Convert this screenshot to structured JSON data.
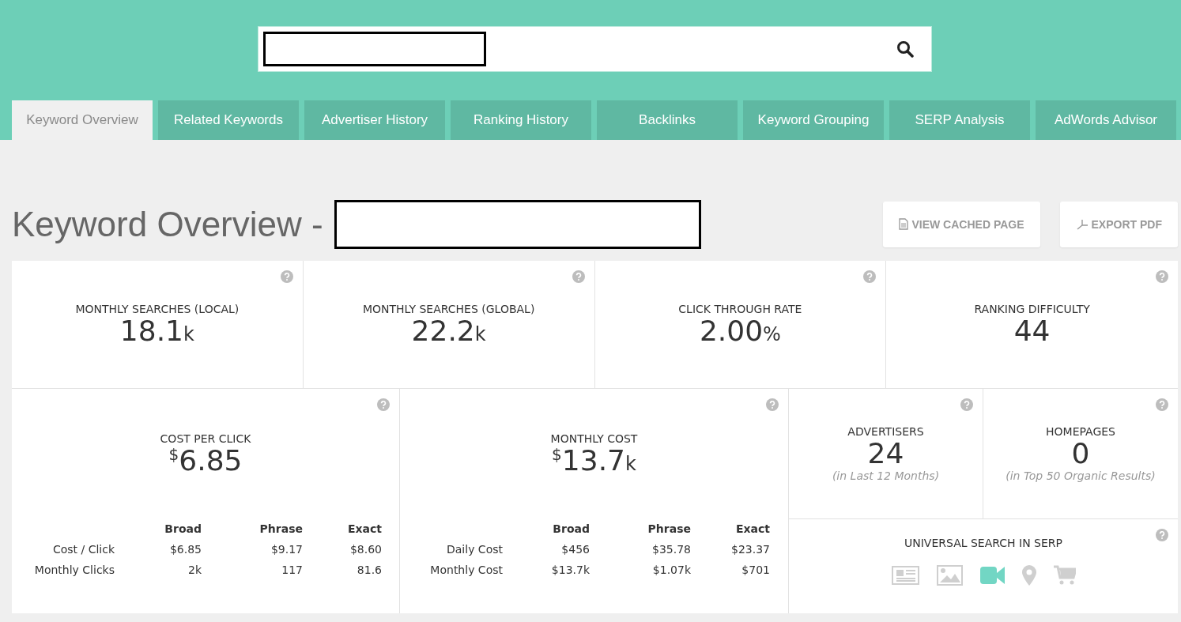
{
  "search": {
    "redacted": true
  },
  "tabs": [
    {
      "label": "Keyword Overview",
      "selected": true
    },
    {
      "label": "Related Keywords",
      "selected": false
    },
    {
      "label": "Advertiser History",
      "selected": false
    },
    {
      "label": "Ranking History",
      "selected": false
    },
    {
      "label": "Backlinks",
      "selected": false
    },
    {
      "label": "Keyword Grouping",
      "selected": false
    },
    {
      "label": "SERP Analysis",
      "selected": false
    },
    {
      "label": "AdWords Advisor",
      "selected": false
    }
  ],
  "page_title": {
    "text": "Keyword Overview -",
    "redacted": true
  },
  "actions": [
    {
      "label": "VIEW CACHED PAGE",
      "kind": "document"
    },
    {
      "label": "EXPORT PDF",
      "kind": "pdf"
    }
  ],
  "metrics": [
    {
      "label": "MONTHLY SEARCHES (LOCAL)",
      "value": "18.1",
      "unit": "k"
    },
    {
      "label": "MONTHLY SEARCHES (GLOBAL)",
      "value": "22.2",
      "unit": "k"
    },
    {
      "label": "CLICK THROUGH RATE",
      "value": "2.00",
      "unit": "%"
    },
    {
      "label": "RANKING DIFFICULTY",
      "value": "44"
    }
  ],
  "cost_panels": [
    {
      "label": "COST PER CLICK",
      "prefix": "$",
      "value": "6.85",
      "columns": [
        "Broad",
        "Phrase",
        "Exact"
      ],
      "rows": [
        {
          "label": "Cost / Click",
          "cells": [
            "$6.85",
            "$9.17",
            "$8.60"
          ]
        },
        {
          "label": "Monthly Clicks",
          "cells": [
            "2k",
            "117",
            "81.6"
          ]
        }
      ]
    },
    {
      "label": "MONTHLY COST",
      "prefix": "$",
      "value": "13.7",
      "unit": "k",
      "columns": [
        "Broad",
        "Phrase",
        "Exact"
      ],
      "rows": [
        {
          "label": "Daily Cost",
          "cells": [
            "$456",
            "$35.78",
            "$23.37"
          ]
        },
        {
          "label": "Monthly Cost",
          "cells": [
            "$13.7k",
            "$1.07k",
            "$701"
          ]
        }
      ]
    }
  ],
  "counts": [
    {
      "label": "ADVERTISERS",
      "value": "24",
      "note": "(in Last 12 Months)"
    },
    {
      "label": "HOMEPAGES",
      "value": "0",
      "note": "(in Top 50 Organic Results)"
    }
  ],
  "universal_search": {
    "label": "UNIVERSAL SEARCH IN SERP",
    "features": [
      {
        "kind": "news",
        "active": false
      },
      {
        "kind": "image",
        "active": false
      },
      {
        "kind": "video",
        "active": true
      },
      {
        "kind": "map",
        "active": false
      },
      {
        "kind": "shopping",
        "active": false
      }
    ]
  }
}
